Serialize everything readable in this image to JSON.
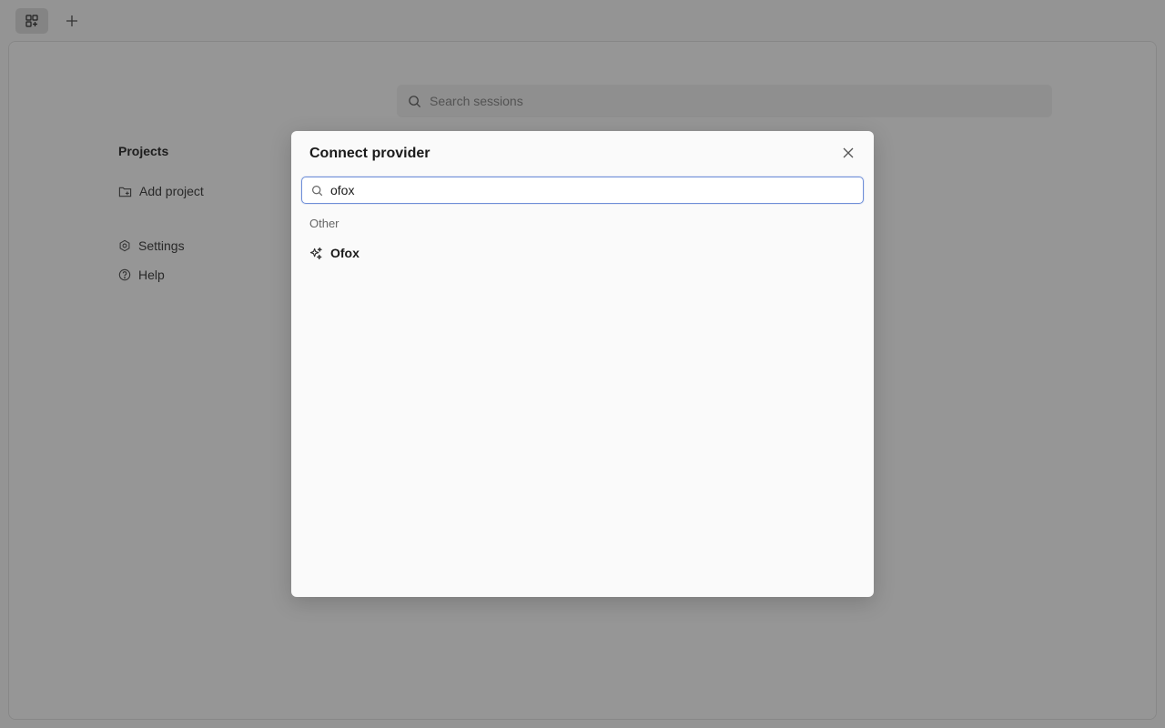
{
  "sessions_search": {
    "placeholder": "Search sessions"
  },
  "sidebar": {
    "heading": "Projects",
    "add_project": "Add project",
    "settings": "Settings",
    "help": "Help"
  },
  "modal": {
    "title": "Connect provider",
    "search_value": "ofox",
    "group_label": "Other",
    "providers": [
      {
        "label": "Ofox",
        "icon": "sparkles-icon"
      }
    ]
  },
  "colors": {
    "focus_border": "#6f8fd8",
    "overlay": "rgba(0,0,0,0.4)"
  }
}
